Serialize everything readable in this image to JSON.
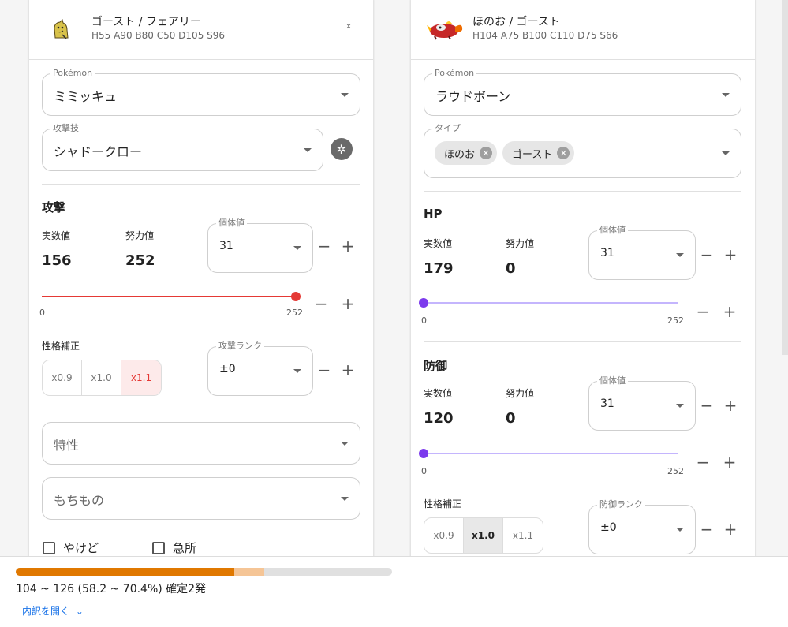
{
  "attacker": {
    "types": "ゴースト / フェアリー",
    "base_stats": "H55 A90 B80 C50 D105 S96",
    "pokemon_label": "Pokémon",
    "pokemon_value": "ミミッキュ",
    "move_label": "攻撃技",
    "move_value": "シャドークロー",
    "attack_section": "攻撃",
    "actual_label": "実数値",
    "ev_label": "努力値",
    "actual_value": "156",
    "ev_value": "252",
    "iv_label": "個体値",
    "iv_value": "31",
    "slider_min": "0",
    "slider_max": "252",
    "ev_fraction": 1.0,
    "nature_label": "性格補正",
    "nature_options": [
      "x0.9",
      "x1.0",
      "x1.1"
    ],
    "nature_selected": "x1.1",
    "rank_label": "攻撃ランク",
    "rank_value": "±0",
    "ability_placeholder": "特性",
    "item_placeholder": "もちもの",
    "burn_label": "やけど",
    "crit_label": "急所",
    "minus": "−",
    "plus": "+"
  },
  "defender": {
    "types": "ほのお / ゴースト",
    "base_stats": "H104 A75 B100 C110 D75 S66",
    "pokemon_label": "Pokémon",
    "pokemon_value": "ラウドボーン",
    "type_label": "タイプ",
    "type_chips": [
      "ほのお",
      "ゴースト"
    ],
    "hp_section": "HP",
    "def_section": "防御",
    "actual_label": "実数値",
    "ev_label": "努力値",
    "hp_actual": "179",
    "hp_ev": "0",
    "def_actual": "120",
    "def_ev": "0",
    "iv_label": "個体値",
    "iv_value": "31",
    "slider_min": "0",
    "slider_max": "252",
    "hp_ev_fraction": 0.0,
    "def_ev_fraction": 0.0,
    "nature_label": "性格補正",
    "nature_options": [
      "x0.9",
      "x1.0",
      "x1.1"
    ],
    "nature_selected": "x1.0",
    "rank_label": "防御ランク",
    "rank_value": "±0",
    "minus": "−",
    "plus": "+"
  },
  "result": {
    "damage_text": "104 ~ 126 (58.2 ~ 70.4%) 確定2発",
    "min_percent": 58.2,
    "max_percent": 70.4,
    "breakdown_link": "内訳を開く",
    "chevron": "⌄"
  },
  "colors": {
    "attack_slider": "#e53935",
    "defense_slider": "#7c3aed",
    "bar_min": "#e07800",
    "bar_max": "#f5c596",
    "link": "#1a73e8"
  },
  "icons": {
    "attacker_sprite": "mimikyu-sprite",
    "defender_sprite": "skeledirge-sprite",
    "collapse": "chevron-up-down-icon",
    "move_settings": "gear-icon"
  }
}
